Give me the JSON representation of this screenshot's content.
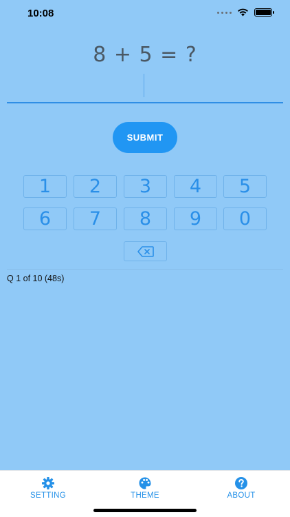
{
  "status": {
    "time": "10:08"
  },
  "question": {
    "text": "8 + 5 = ?"
  },
  "answer": {
    "value": ""
  },
  "submit": {
    "label": "SUBMIT"
  },
  "keypad": {
    "keys": [
      "1",
      "2",
      "3",
      "4",
      "5",
      "6",
      "7",
      "8",
      "9",
      "0"
    ],
    "backspace_icon": "backspace-icon"
  },
  "progress": {
    "text": "Q 1 of 10 (48s)"
  },
  "tabs": [
    {
      "label": "SETTING",
      "icon": "gear-icon"
    },
    {
      "label": "THEME",
      "icon": "palette-icon"
    },
    {
      "label": "ABOUT",
      "icon": "question-circle-icon"
    }
  ],
  "colors": {
    "background": "#90c9f7",
    "accent": "#2196f3",
    "tab_bar": "#ffffff"
  }
}
